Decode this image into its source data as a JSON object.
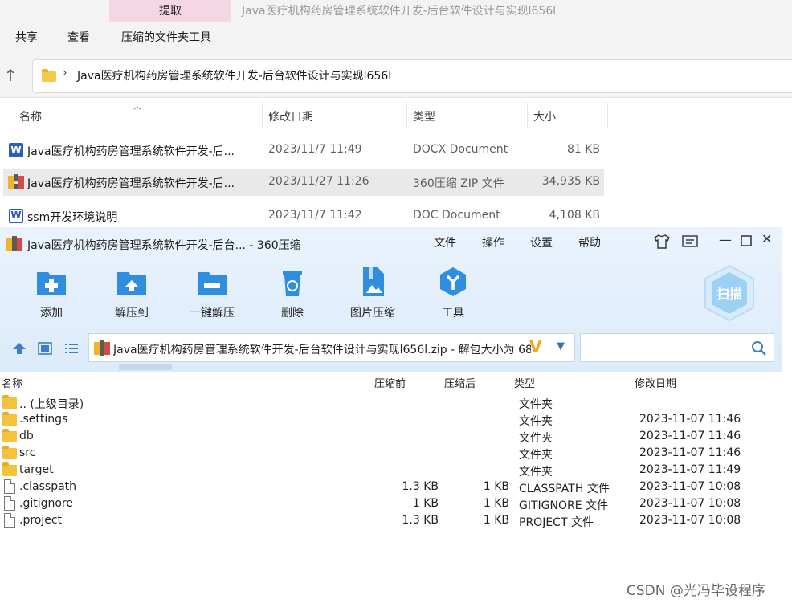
{
  "explorer": {
    "tool_tab": "提取",
    "title": "Java医疗机构药房管理系统软件开发-后台软件设计与实现l656l",
    "ribbon": [
      "共享",
      "查看",
      "压缩的文件夹工具"
    ],
    "address": "Java医疗机构药房管理系统软件开发-后台软件设计与实现l656l",
    "columns": {
      "name": "名称",
      "date": "修改日期",
      "type": "类型",
      "size": "大小"
    },
    "files": [
      {
        "name": "Java医疗机构药房管理系统软件开发-后...",
        "date": "2023/11/7 11:49",
        "type": "DOCX Document",
        "size": "81 KB",
        "icon": "word-icon"
      },
      {
        "name": "Java医疗机构药房管理系统软件开发-后...",
        "date": "2023/11/27 11:26",
        "type": "360压缩 ZIP 文件",
        "size": "34,935 KB",
        "icon": "zip-archive-icon",
        "selected": true
      },
      {
        "name": "ssm开发环境说明",
        "date": "2023/11/7 11:42",
        "type": "DOC Document",
        "size": "4,108 KB",
        "icon": "word-doc-icon"
      }
    ]
  },
  "zip": {
    "title": "Java医疗机构药房管理系统软件开发-后台... - 360压缩",
    "menu": [
      "文件",
      "操作",
      "设置",
      "帮助"
    ],
    "toolbar": [
      "添加",
      "解压到",
      "一键解压",
      "删除",
      "图片压缩",
      "工具"
    ],
    "scan_label": "扫描",
    "path": "Java医疗机构药房管理系统软件开发-后台软件设计与实现l656l.zip - 解包大小为 68",
    "columns": {
      "name": "名称",
      "before": "压缩前",
      "after": "压缩后",
      "type": "类型",
      "date": "修改日期"
    },
    "rows": [
      {
        "name": ".. (上级目录)",
        "before": "",
        "after": "",
        "type": "文件夹",
        "date": "",
        "icon": "folder-icon"
      },
      {
        "name": ".settings",
        "before": "",
        "after": "",
        "type": "文件夹",
        "date": "2023-11-07 11:46",
        "icon": "folder-icon"
      },
      {
        "name": "db",
        "before": "",
        "after": "",
        "type": "文件夹",
        "date": "2023-11-07 11:46",
        "icon": "folder-icon"
      },
      {
        "name": "src",
        "before": "",
        "after": "",
        "type": "文件夹",
        "date": "2023-11-07 11:46",
        "icon": "folder-icon"
      },
      {
        "name": "target",
        "before": "",
        "after": "",
        "type": "文件夹",
        "date": "2023-11-07 11:49",
        "icon": "folder-icon"
      },
      {
        "name": ".classpath",
        "before": "1.3 KB",
        "after": "1 KB",
        "type": "CLASSPATH 文件",
        "date": "2023-11-07 10:08",
        "icon": "file-icon"
      },
      {
        "name": ".gitignore",
        "before": "1 KB",
        "after": "1 KB",
        "type": "GITIGNORE 文件",
        "date": "2023-11-07 10:08",
        "icon": "file-icon"
      },
      {
        "name": ".project",
        "before": "1.3 KB",
        "after": "1 KB",
        "type": "PROJECT 文件",
        "date": "2023-11-07 10:08",
        "icon": "file-icon"
      }
    ]
  },
  "watermark": "CSDN @光冯毕设程序"
}
